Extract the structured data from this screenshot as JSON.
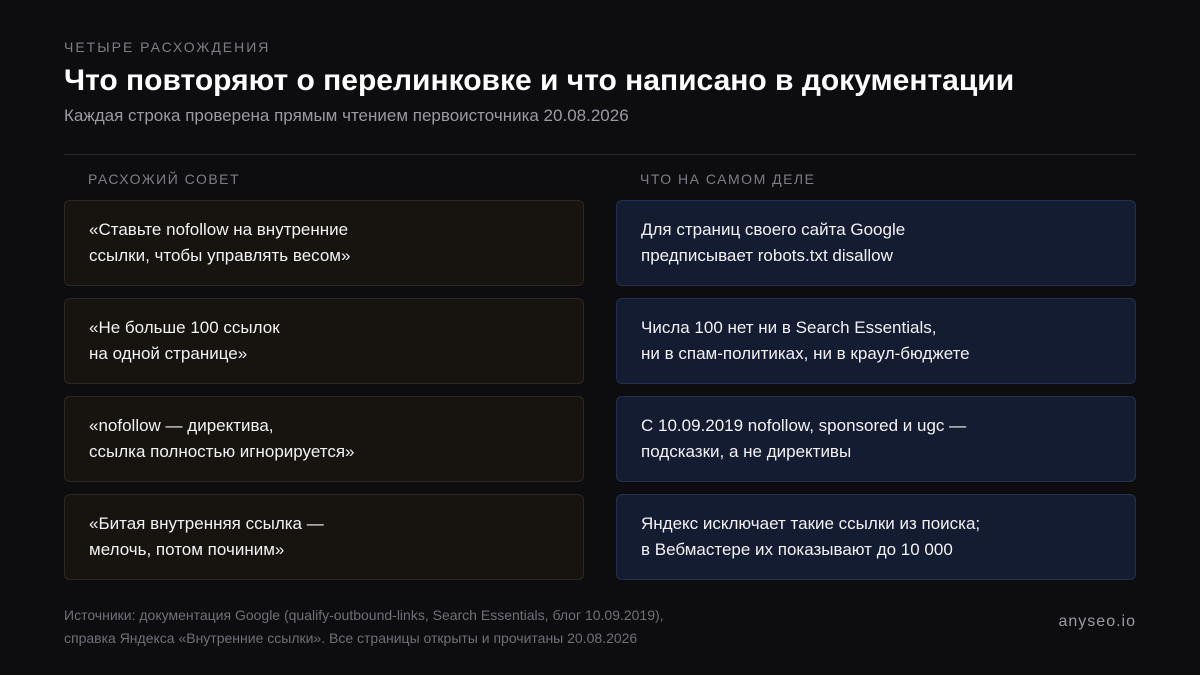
{
  "header": {
    "eyebrow": "ЧЕТЫРЕ РАСХОЖДЕНИЯ",
    "title": "Что повторяют о перелинковке и что написано в документации",
    "subtitle": "Каждая строка проверена прямым чтением первоисточника 20.08.2026"
  },
  "columns": {
    "myth_label": "РАСХОЖИЙ СОВЕТ",
    "fact_label": "ЧТО НА САМОМ ДЕЛЕ"
  },
  "rows": [
    {
      "myth": [
        "«Ставьте nofollow на внутренние",
        "ссылки, чтобы управлять весом»"
      ],
      "fact": [
        "Для страниц своего сайта Google",
        "предписывает robots.txt disallow"
      ]
    },
    {
      "myth": [
        "«Не больше 100 ссылок",
        "на одной странице»"
      ],
      "fact": [
        "Числа 100 нет ни в Search Essentials,",
        "ни в спам-политиках, ни в краул-бюджете"
      ]
    },
    {
      "myth": [
        "«nofollow — директива,",
        "ссылка полностью игнорируется»"
      ],
      "fact": [
        "С 10.09.2019 nofollow, sponsored и ugc —",
        "подсказки, а не директивы"
      ]
    },
    {
      "myth": [
        "«Битая внутренняя ссылка —",
        "мелочь, потом починим»"
      ],
      "fact": [
        "Яндекс исключает такие ссылки из поиска;",
        "в Вебмастере их показывают до 10 000"
      ]
    }
  ],
  "footer": {
    "sources": [
      "Источники: документация Google (qualify-outbound-links, Search Essentials, блог 10.09.2019),",
      "справка Яндекса «Внутренние ссылки». Все страницы открыты и прочитаны 20.08.2026"
    ],
    "brand": "anyseo.io"
  }
}
